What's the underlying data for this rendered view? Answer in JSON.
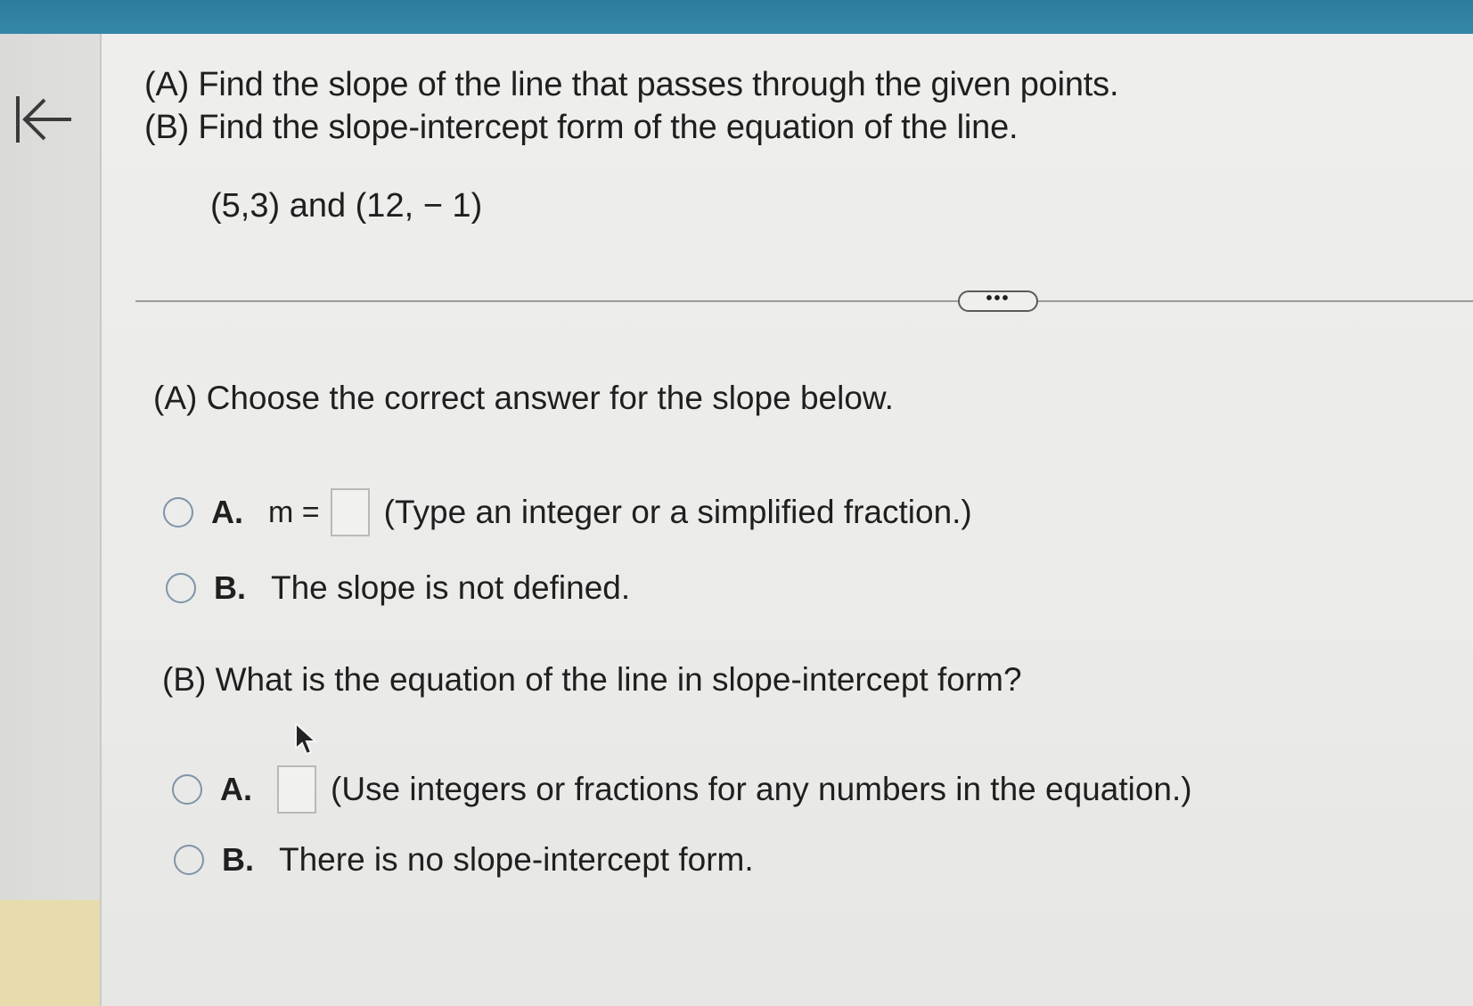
{
  "question": {
    "line_a": "(A) Find the slope of the line that passes through the given points.",
    "line_b": "(B) Find the slope-intercept form of the equation of the line.",
    "points": "(5,3) and (12, − 1)"
  },
  "more_button": {
    "label": "•••"
  },
  "part_a": {
    "heading": "(A) Choose the correct answer for the slope below.",
    "option_a": {
      "letter": "A.",
      "prefix": "m =",
      "hint": "(Type an integer or a simplified fraction.)"
    },
    "option_b": {
      "letter": "B.",
      "text": "The slope is not defined."
    }
  },
  "part_b": {
    "heading": "(B) What is the equation of the line in slope-intercept form?",
    "option_a": {
      "letter": "A.",
      "hint": "(Use integers or fractions for any numbers in the equation.)"
    },
    "option_b": {
      "letter": "B.",
      "text": "There is no slope-intercept form."
    }
  },
  "icons": {
    "back": "back-to-start-icon",
    "radio": "radio-button-icon",
    "cursor": "mouse-pointer-icon"
  },
  "colors": {
    "top_bar": "#2e7c9d",
    "radio_border": "#7e94a8",
    "rail_highlight": "#e6dcae"
  }
}
